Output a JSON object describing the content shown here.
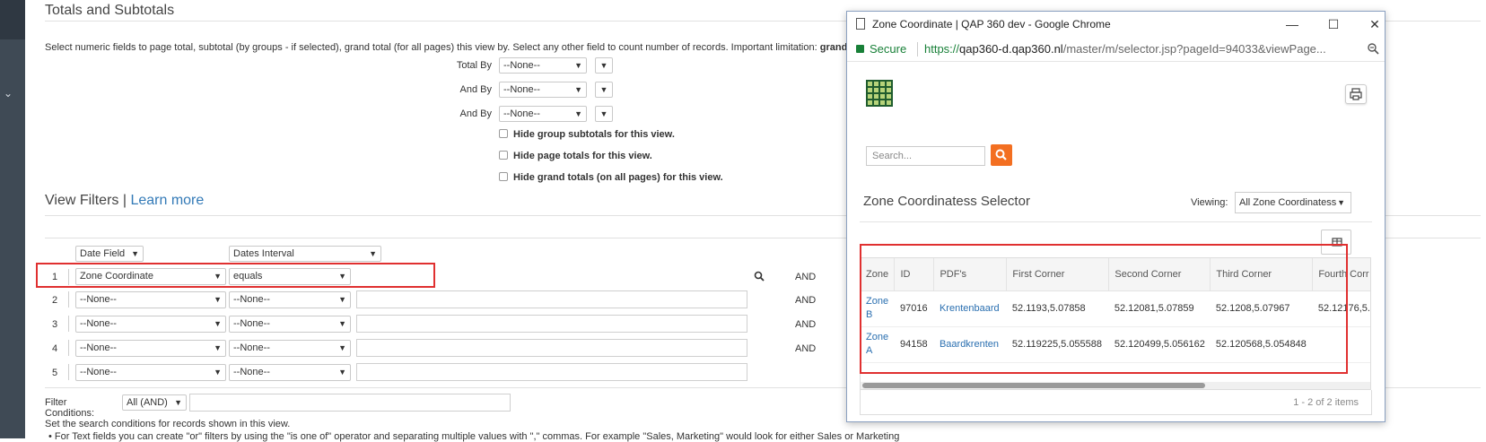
{
  "totals": {
    "title": "Totals and Subtotals",
    "description_a": "Select numeric fields to page total, subtotal (by groups - if selected), grand total (for all pages) this view by. Select any other field to count number of records. Important limitation:",
    "description_b": "grand total ca",
    "total_by_label": "Total By",
    "and_by_label": "And By",
    "none_option": "--None--",
    "hide_group": "Hide group subtotals for this view.",
    "hide_page": "Hide page totals for this view.",
    "hide_grand": "Hide grand totals (on all pages) for this view."
  },
  "filters": {
    "title": "View Filters",
    "separator": "|",
    "learn_more": "Learn more",
    "date_field": "Date Field",
    "dates_interval": "Dates Interval",
    "rows": [
      {
        "num": "1",
        "field": "Zone Coordinate",
        "op": "equals",
        "and": "AND"
      },
      {
        "num": "2",
        "field": "--None--",
        "op": "--None--",
        "and": "AND"
      },
      {
        "num": "3",
        "field": "--None--",
        "op": "--None--",
        "and": "AND"
      },
      {
        "num": "4",
        "field": "--None--",
        "op": "--None--",
        "and": "AND"
      },
      {
        "num": "5",
        "field": "--None--",
        "op": "--None--",
        "and": ""
      }
    ],
    "conditions_label": "Filter Conditions:",
    "conditions_value": "All (AND)",
    "note1": "Set the search conditions for records shown in this view.",
    "note2": "For Text fields you can create \"or\" filters by using the \"is one of\" operator and separating multiple values with \",\" commas. For example \"Sales, Marketing\" would look for either Sales or Marketing"
  },
  "popup": {
    "window_title": "Zone Coordinate | QAP 360 dev - Google Chrome",
    "secure": "Secure",
    "url_scheme": "https://",
    "url_host": "qap360-d.qap360.nl",
    "url_path": "/master/m/selector.jsp?pageId=94033&viewPage...",
    "search_placeholder": "Search...",
    "selector_title": "Zone Coordinatess Selector",
    "viewing_label": "Viewing:",
    "viewing_value": "All Zone Coordinatess",
    "columns": [
      "Zone",
      "ID",
      "PDF's",
      "First Corner",
      "Second Corner",
      "Third Corner",
      "Fourth Corr"
    ],
    "rows": [
      {
        "zone": "Zone B",
        "id": "97016",
        "pdf": "Krentenbaard",
        "c1": "52.1193,5.07858",
        "c2": "52.12081,5.07859",
        "c3": "52.1208,5.07967",
        "c4": "52.12176,5."
      },
      {
        "zone": "Zone A",
        "id": "94158",
        "pdf": "Baardkrenten",
        "c1": "52.119225,5.055588",
        "c2": "52.120499,5.056162",
        "c3": "52.120568,5.054848",
        "c4": ""
      }
    ],
    "items_count": "1 - 2 of 2 items",
    "colors": {
      "secure": "#188038",
      "search_btn": "#f36f21",
      "link": "#2a6fb0",
      "highlight": "#e03030"
    }
  }
}
